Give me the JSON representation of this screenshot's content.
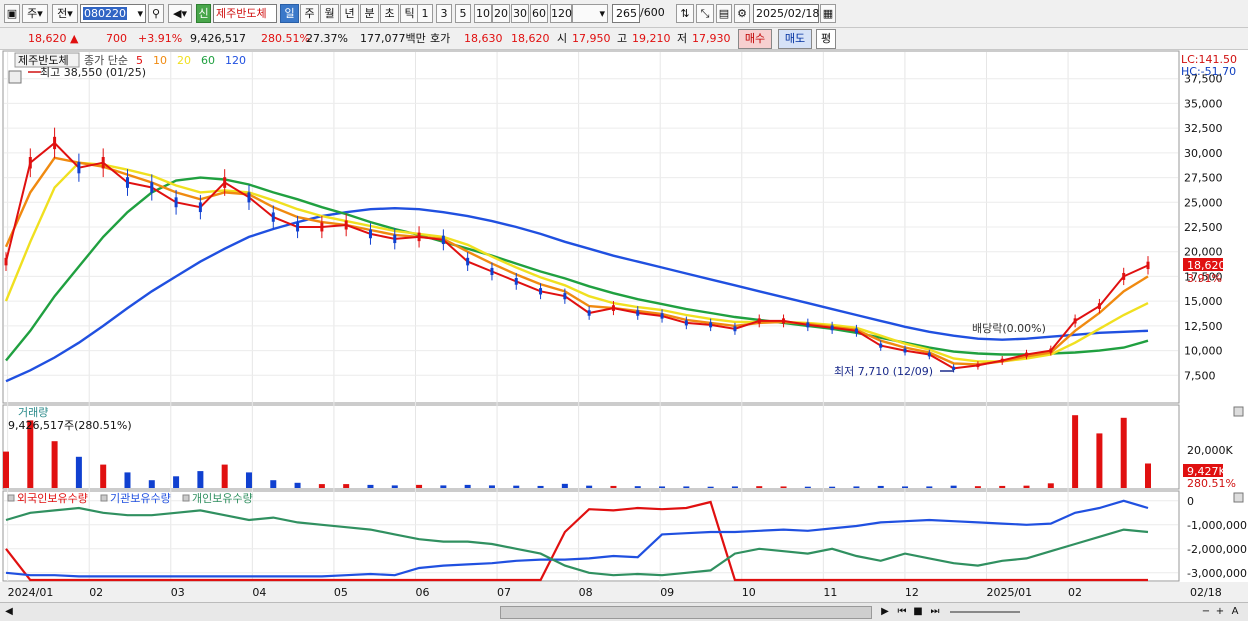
{
  "toolbar": {
    "type_label": "주",
    "prev_label": "전",
    "code": "080220",
    "new_badge": "신",
    "stock_name": "제주반도체",
    "periods": [
      "일",
      "주",
      "월",
      "년",
      "분",
      "초",
      "틱"
    ],
    "intervals": [
      "1",
      "3",
      "5",
      "10",
      "20",
      "30",
      "60",
      "120"
    ],
    "count": "265",
    "count_total": "/600",
    "date": "2025/02/18"
  },
  "info": {
    "price": "18,620",
    "change": "700",
    "change_pct": "+3.91%",
    "volume": "9,426,517",
    "vol_ratio": "280.51%",
    "turnover": "27.37%",
    "amount": "177,077백만",
    "quote_label": "호가",
    "ask": "18,630",
    "bid": "18,620",
    "open_label": "시",
    "open": "17,950",
    "high_label": "고",
    "high": "19,210",
    "low_label": "저",
    "low": "17,930",
    "buy_btn": "매수",
    "sell_btn": "매도",
    "eval_btn": "평"
  },
  "colors": {
    "ma5": "#e01010",
    "ma10": "#f08a10",
    "ma20": "#f0e020",
    "ma60": "#20a040",
    "ma120": "#2050e0",
    "up": "#e01010",
    "down": "#1040d0",
    "foreign": "#e01010",
    "institution": "#2050e0",
    "individual": "#309060"
  },
  "price_panel": {
    "name_tag": "제주반도체",
    "legend_label": "종가 단순",
    "ma_periods": [
      "5",
      "10",
      "20",
      "60",
      "120"
    ],
    "high_note": "최고 38,550 (01/25)",
    "low_note": "최저 7,710 (12/09)",
    "dividend_note": "배당락(0.00%)",
    "lc_label": "LC:141.50",
    "hc_label": "HC:-51.70",
    "price_tag": "18,620",
    "pct_tag": "3.91%",
    "y_ticks": [
      "37,500",
      "35,000",
      "32,500",
      "30,000",
      "27,500",
      "25,000",
      "22,500",
      "20,000",
      "17,500",
      "15,000",
      "12,500",
      "10,000",
      "7,500"
    ]
  },
  "volume_panel": {
    "title": "거래량",
    "value_text": "9,426,517주(280.51%)",
    "y_tick": "20,000K",
    "vol_tag": "9,427K",
    "pct_tag": "280.51%"
  },
  "holdings_panel": {
    "legend": [
      "외국인보유수량",
      "기관보유수량",
      "개인보유수량"
    ],
    "y_ticks": [
      "0",
      "-1,000,000",
      "-2,000,000",
      "-3,000,000"
    ]
  },
  "x_axis": {
    "labels": [
      "2024/01",
      "02",
      "03",
      "04",
      "05",
      "06",
      "07",
      "08",
      "09",
      "10",
      "11",
      "12",
      "2025/01",
      "02"
    ],
    "right_label": "02/18"
  },
  "chart_data": [
    {
      "type": "line",
      "panel": "price",
      "ylim": [
        5000,
        40000
      ],
      "series": [
        {
          "name": "종가",
          "values": [
            19000,
            29000,
            31000,
            28500,
            29000,
            27000,
            26500,
            25000,
            24500,
            27000,
            25500,
            23500,
            22500,
            22500,
            22700,
            21800,
            21300,
            21500,
            21200,
            19000,
            18000,
            17000,
            16000,
            15500,
            13800,
            14300,
            13800,
            13500,
            12800,
            12600,
            12200,
            13000,
            13000,
            12600,
            12300,
            12000,
            10500,
            10000,
            9600,
            8200,
            8500,
            9000,
            9600,
            10000,
            13000,
            14500,
            17500,
            18620
          ]
        },
        {
          "name": "5",
          "values": [
            19000,
            29000,
            31000,
            28500,
            29000,
            27000,
            26500,
            25000,
            24500,
            27000,
            25500,
            23500,
            22500,
            22500,
            22700,
            21800,
            21300,
            21500,
            21200,
            19000,
            18000,
            17000,
            16000,
            15500,
            13800,
            14300,
            13800,
            13500,
            12800,
            12600,
            12200,
            13000,
            13000,
            12600,
            12300,
            12000,
            10500,
            10000,
            9600,
            8200,
            8500,
            9000,
            9600,
            10000,
            13000,
            14500,
            17500,
            18620
          ]
        },
        {
          "name": "10",
          "values": [
            20500,
            26000,
            29500,
            29000,
            28600,
            27800,
            27000,
            26000,
            25300,
            26000,
            25800,
            24500,
            23500,
            23000,
            22700,
            22200,
            21700,
            21500,
            21300,
            20000,
            18800,
            17700,
            16700,
            16000,
            14500,
            14300,
            14000,
            13700,
            13100,
            12800,
            12500,
            12800,
            12900,
            12700,
            12400,
            12100,
            11000,
            10300,
            9800,
            8700,
            8600,
            8900,
            9400,
            9800,
            12000,
            13800,
            16000,
            17500
          ]
        },
        {
          "name": "20",
          "values": [
            15000,
            21000,
            26500,
            29000,
            28800,
            28300,
            27700,
            26700,
            26000,
            26200,
            26000,
            25200,
            24300,
            23600,
            23100,
            22600,
            22100,
            21800,
            21500,
            20700,
            19500,
            18400,
            17400,
            16600,
            15500,
            14800,
            14400,
            14100,
            13600,
            13200,
            12900,
            12900,
            12900,
            12800,
            12600,
            12300,
            11500,
            10700,
            10100,
            9200,
            8900,
            8900,
            9200,
            9600,
            10800,
            12200,
            13600,
            14800
          ]
        },
        {
          "name": "60",
          "values": [
            9000,
            12000,
            15500,
            18500,
            21500,
            24000,
            26000,
            27200,
            27500,
            27300,
            26800,
            26000,
            25300,
            24500,
            23800,
            23000,
            22300,
            21700,
            21000,
            20300,
            19600,
            18800,
            18000,
            17300,
            16500,
            15800,
            15200,
            14700,
            14200,
            13800,
            13400,
            13100,
            12800,
            12500,
            12200,
            11800,
            11300,
            10800,
            10300,
            9900,
            9700,
            9600,
            9600,
            9700,
            9800,
            10000,
            10300,
            11000
          ]
        },
        {
          "name": "120",
          "values": [
            6900,
            8000,
            9300,
            10800,
            12500,
            14300,
            16000,
            17500,
            19000,
            20300,
            21500,
            22300,
            23000,
            23600,
            24000,
            24300,
            24400,
            24300,
            24000,
            23600,
            23100,
            22500,
            21800,
            21000,
            20300,
            19600,
            19000,
            18400,
            17800,
            17200,
            16600,
            16000,
            15400,
            14800,
            14200,
            13600,
            13000,
            12400,
            11900,
            11500,
            11200,
            11100,
            11200,
            11400,
            11600,
            11800,
            11900,
            12000
          ]
        }
      ]
    },
    {
      "type": "bar",
      "panel": "volume",
      "ylim": [
        0,
        30000
      ],
      "series": [
        {
          "name": "거래량",
          "values": [
            14000,
            26000,
            18000,
            12000,
            9000,
            6000,
            3000,
            4500,
            6500,
            9000,
            6000,
            3000,
            2000,
            1500,
            1500,
            1200,
            1000,
            1200,
            1000,
            1200,
            1000,
            900,
            800,
            1600,
            900,
            800,
            700,
            600,
            600,
            500,
            600,
            700,
            600,
            500,
            500,
            600,
            800,
            600,
            600,
            900,
            700,
            800,
            900,
            1800,
            28000,
            21000,
            27000,
            9427
          ]
        }
      ]
    },
    {
      "type": "line",
      "panel": "holdings",
      "ylim": [
        -3300000,
        200000
      ],
      "series": [
        {
          "name": "외국인보유수량",
          "values": [
            -2000000,
            -3300000,
            -3300000,
            -3300000,
            -3300000,
            -3300000,
            -3300000,
            -3300000,
            -3300000,
            -3300000,
            -3300000,
            -3300000,
            -3300000,
            -3300000,
            -3300000,
            -3300000,
            -3300000,
            -3300000,
            -3300000,
            -3300000,
            -3300000,
            -3300000,
            -3300000,
            -1300000,
            -350000,
            -400000,
            -300000,
            -350000,
            -300000,
            -50000,
            -3300000,
            -3300000,
            -3300000,
            -3300000,
            -3300000,
            -3300000,
            -3300000,
            -3300000,
            -3300000,
            -3300000,
            -3300000,
            -3300000,
            -3300000,
            -3300000,
            -3300000,
            -3300000,
            -3300000,
            -3300000
          ]
        },
        {
          "name": "기관보유수량",
          "values": [
            -3000000,
            -3100000,
            -3100000,
            -3150000,
            -3150000,
            -3150000,
            -3150000,
            -3150000,
            -3150000,
            -3150000,
            -3150000,
            -3150000,
            -3150000,
            -3150000,
            -3100000,
            -3050000,
            -3100000,
            -2800000,
            -2700000,
            -2650000,
            -2600000,
            -2500000,
            -2450000,
            -2450000,
            -2400000,
            -2300000,
            -2350000,
            -1400000,
            -1350000,
            -1300000,
            -1300000,
            -1250000,
            -1200000,
            -1250000,
            -1150000,
            -1050000,
            -900000,
            -850000,
            -800000,
            -850000,
            -900000,
            -950000,
            -1000000,
            -950000,
            -500000,
            -300000,
            0,
            -300000
          ]
        },
        {
          "name": "개인보유수량",
          "values": [
            -800000,
            -500000,
            -400000,
            -300000,
            -500000,
            -600000,
            -600000,
            -500000,
            -400000,
            -600000,
            -800000,
            -700000,
            -900000,
            -1000000,
            -1100000,
            -1200000,
            -1400000,
            -1600000,
            -1700000,
            -1700000,
            -1800000,
            -2000000,
            -2200000,
            -2700000,
            -3000000,
            -3100000,
            -3050000,
            -3100000,
            -3000000,
            -2900000,
            -2200000,
            -2000000,
            -2100000,
            -2200000,
            -2000000,
            -2300000,
            -2500000,
            -2200000,
            -2400000,
            -2600000,
            -2700000,
            -2500000,
            -2400000,
            -2100000,
            -1800000,
            -1500000,
            -1200000,
            -1300000
          ]
        }
      ]
    }
  ]
}
